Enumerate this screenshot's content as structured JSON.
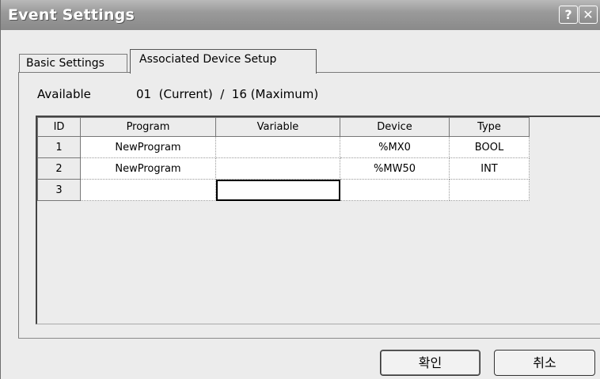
{
  "window": {
    "title": "Event Settings",
    "help_glyph": "?",
    "close_glyph": "✕"
  },
  "tabs": [
    {
      "label": "Basic Settings",
      "active": false
    },
    {
      "label": "Associated Device Setup",
      "active": true
    }
  ],
  "available": {
    "label": "Available",
    "value": "01  (Current)  /  16 (Maximum)"
  },
  "grid": {
    "headers": [
      "ID",
      "Program",
      "Variable",
      "Device",
      "Type"
    ],
    "rows": [
      {
        "id": "1",
        "program": "NewProgram",
        "variable": "",
        "device": "%MX0",
        "type": "BOOL"
      },
      {
        "id": "2",
        "program": "NewProgram",
        "variable": "",
        "device": "%MW50",
        "type": "INT"
      },
      {
        "id": "3",
        "program": "",
        "variable": "",
        "device": "",
        "type": ""
      }
    ]
  },
  "buttons": {
    "ok": "확인",
    "cancel": "취소"
  }
}
